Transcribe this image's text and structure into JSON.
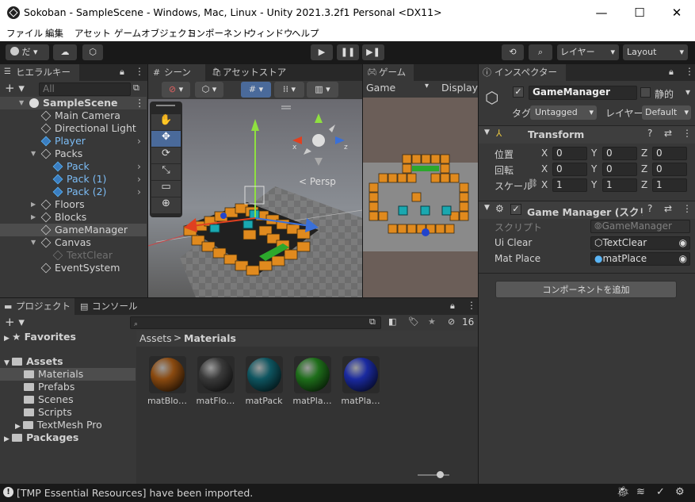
{
  "window": {
    "title": "Sokoban - SampleScene - Windows, Mac, Linux - Unity 2021.3.2f1 Personal <DX11>",
    "min": "—",
    "max": "☐",
    "close": "✕"
  },
  "menu": [
    "ファイル",
    "編集",
    "アセット",
    "ゲームオブジェクト",
    "コンポーネント",
    "ウィンドウ",
    "ヘルプ"
  ],
  "toolbar": {
    "account": "だ",
    "layers": "レイヤー",
    "layout": "Layout"
  },
  "hierarchy": {
    "tab": "ヒエラルキー",
    "search_placeholder": "All",
    "items": [
      {
        "label": "SampleScene",
        "kind": "scene"
      },
      {
        "label": "Main Camera",
        "kind": "obj"
      },
      {
        "label": "Directional Light",
        "kind": "obj"
      },
      {
        "label": "Player",
        "kind": "prefab"
      },
      {
        "label": "Packs",
        "kind": "obj"
      },
      {
        "label": "Pack",
        "kind": "prefab"
      },
      {
        "label": "Pack (1)",
        "kind": "prefab"
      },
      {
        "label": "Pack (2)",
        "kind": "prefab"
      },
      {
        "label": "Floors",
        "kind": "obj"
      },
      {
        "label": "Blocks",
        "kind": "obj"
      },
      {
        "label": "GameManager",
        "kind": "obj"
      },
      {
        "label": "Canvas",
        "kind": "obj"
      },
      {
        "label": "TextClear",
        "kind": "disabled"
      },
      {
        "label": "EventSystem",
        "kind": "obj"
      }
    ]
  },
  "scene": {
    "tab": "シーン",
    "tab2": "アセットストア",
    "persp": "Persp",
    "axis_x": "x",
    "axis_z": "z"
  },
  "game": {
    "tab": "ゲーム",
    "display_name": "Game",
    "display": "Display"
  },
  "inspector": {
    "tab": "インスペクター",
    "object_name": "GameManager",
    "static": "静的",
    "tag_label": "タグ",
    "tag": "Untagged",
    "layer_label": "レイヤー",
    "layer": "Default",
    "transform": {
      "title": "Transform",
      "position": "位置",
      "rotation": "回転",
      "scale": "スケール",
      "pos": [
        "0",
        "0",
        "0"
      ],
      "rot": [
        "0",
        "0",
        "0"
      ],
      "scl": [
        "1",
        "1",
        "1"
      ],
      "x": "X",
      "y": "Y",
      "z": "Z"
    },
    "component": {
      "title": "Game Manager (スクリプト)",
      "script_label": "スクリプト",
      "script": "GameManager",
      "ui_clear_label": "Ui Clear",
      "ui_clear": "TextClear",
      "mat_place_label": "Mat Place",
      "mat_place": "matPlace"
    },
    "add_component": "コンポーネントを追加"
  },
  "project": {
    "tab": "プロジェクト",
    "tab2": "コンソール",
    "count": "16",
    "favorites": "Favorites",
    "assets": "Assets",
    "folders": [
      "Materials",
      "Prefabs",
      "Scenes",
      "Scripts",
      "TextMesh Pro"
    ],
    "packages": "Packages",
    "breadcrumb_root": "Assets",
    "breadcrumb_current": "Materials",
    "materials": [
      {
        "label": "matBlo…",
        "color": "#8a4a10"
      },
      {
        "label": "matFlo…",
        "color": "#3a3a3a"
      },
      {
        "label": "matPack",
        "color": "#0e5560"
      },
      {
        "label": "matPla…",
        "color": "#1e6e1a"
      },
      {
        "label": "matPla…",
        "color": "#1a2aa0"
      }
    ]
  },
  "status": {
    "message": "[TMP Essential Resources] have been imported."
  }
}
